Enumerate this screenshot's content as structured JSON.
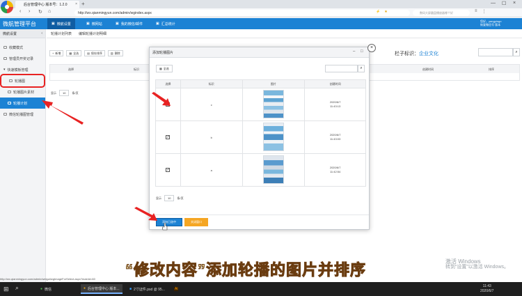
{
  "browser": {
    "tab_title": "后台管理中心 版本号：1.2.0",
    "close": "×",
    "new_tab": "+",
    "url": "http://wx.qianmingyun.com/admin/wgindex.aspx",
    "search_placeholder": "数码大屏圆盘播放器哪个好",
    "nav_back": "‹",
    "nav_forward": "›",
    "nav_refresh": "↻",
    "nav_home": "⌂",
    "window_min": "—",
    "window_max": "☐",
    "window_close": "×"
  },
  "app": {
    "brand": "微航管理平台",
    "nav": [
      {
        "label": "微航设置"
      },
      {
        "label": "微网站"
      },
      {
        "label": "我的微信/邮件"
      },
      {
        "label": "汇总统计"
      }
    ],
    "user_line1": "您好，yangpingo",
    "user_line2": "恢复微信号 版本"
  },
  "sidebar": {
    "title": "微航设置",
    "items": [
      {
        "label": "收藏模式"
      },
      {
        "label": "管理员开奖记录"
      },
      {
        "label": "快速模板管理"
      },
      {
        "label": "轮播图"
      },
      {
        "label": "轮播图片素材"
      },
      {
        "label": "轮播计划"
      },
      {
        "label": "微信轮播图管理"
      }
    ]
  },
  "content": {
    "breadcrumb": [
      "轮播计划列表",
      "编辑轮播计划明细"
    ],
    "toolbar": [
      {
        "label": "新增"
      },
      {
        "label": "全选"
      },
      {
        "label": "保存排序"
      },
      {
        "label": "删除"
      }
    ],
    "column_prefix": "栏子标识：",
    "column_value": "企业文化",
    "headers": [
      "选择",
      "标识",
      "创建时间",
      "排序"
    ],
    "pager": {
      "show": "显示",
      "size": "10",
      "unit": "条/页"
    }
  },
  "modal": {
    "title": "添加轮播图片",
    "select_all": "全选",
    "headers": [
      "选择",
      "标识",
      "图片",
      "创建时间"
    ],
    "rows": [
      {
        "checked": "✓",
        "id": "c",
        "date": "2020/6/7",
        "time": "11:43:13"
      },
      {
        "checked": "✓",
        "id": "b",
        "date": "2020/6/7",
        "time": "11:43:03"
      },
      {
        "checked": "✓",
        "id": "a",
        "date": "2020/6/7",
        "time": "11:42:54"
      }
    ],
    "pager": {
      "show": "显示",
      "size": "10",
      "unit": "条/页"
    },
    "add_button": "添加已选中",
    "close_button": "关闭窗口"
  },
  "caption": "“修改内容”添加轮播的图片并排序",
  "watermark": {
    "line1": "激活 Windows",
    "line2": "转到“设置”以激活 Windows。"
  },
  "status_url": "http://wx.qianmingyun.com/admin/weigui/wgImageForSelect.aspx?mainId=60",
  "taskbar": {
    "apps": [
      {
        "label": "微信"
      },
      {
        "label": "后台管理中心 版本..."
      },
      {
        "label": "2寸证件.psd @ 95..."
      },
      {
        "label": "Ai"
      }
    ],
    "time": "11:43",
    "date": "2020/6/7"
  },
  "colors": {
    "accent": "#1c82d4",
    "highlight": "#e82222",
    "close_button": "#f5a623"
  }
}
